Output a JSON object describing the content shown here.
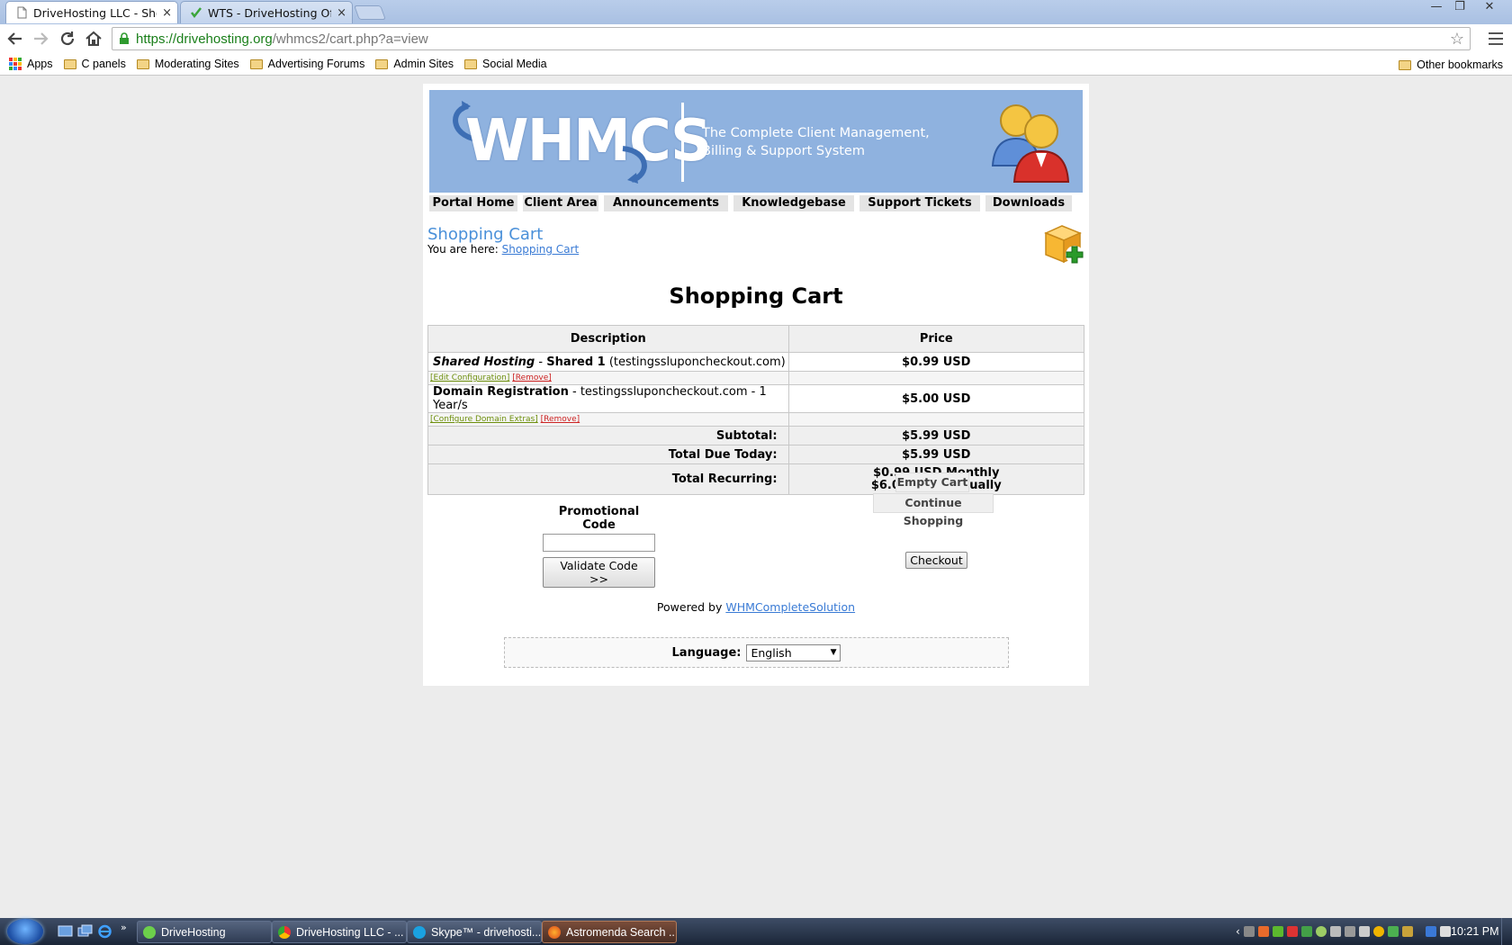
{
  "browser": {
    "tabs": [
      {
        "title": "DriveHosting LLC - Shopp",
        "active": true
      },
      {
        "title": "WTS - DriveHosting Offici",
        "active": false
      }
    ],
    "close_glyph": "×",
    "window_controls": {
      "minimize": "—",
      "restore": "❐",
      "close": "✕"
    },
    "url_scheme_host": "https://drivehosting.org",
    "url_path": "/whmcs2/cart.php?a=view",
    "bookmarks": [
      "Apps",
      "C panels",
      "Moderating Sites",
      "Advertising Forums",
      "Admin Sites",
      "Social Media"
    ],
    "other_bookmarks": "Other bookmarks"
  },
  "banner": {
    "logo": "WHMCS",
    "tagline_line1": "The Complete Client Management,",
    "tagline_line2": "Billing & Support System"
  },
  "nav": {
    "items": [
      "Portal Home",
      "Client Area",
      "Announcements",
      "Knowledgebase",
      "Support Tickets",
      "Downloads"
    ]
  },
  "page": {
    "heading": "Shopping Cart",
    "breadcrumb_prefix": "You are here:",
    "breadcrumb_link": "Shopping Cart",
    "cart_title": "Shopping Cart"
  },
  "cart": {
    "col_description": "Description",
    "col_price": "Price",
    "items": [
      {
        "category": "Shared Hosting",
        "sep": " - ",
        "name": "Shared 1",
        "detail": " (testingssluponcheckout.com)",
        "price": "$0.99 USD",
        "link1": "[Edit Configuration]",
        "link2": "[Remove]"
      },
      {
        "category": "Domain Registration",
        "sep": " - ",
        "name": "",
        "detail": "testingssluponcheckout.com - 1 Year/s",
        "price": "$5.00 USD",
        "link1": "[Configure Domain Extras]",
        "link2": "[Remove]"
      }
    ],
    "subtotal_label": "Subtotal:",
    "subtotal_value": "$5.99 USD",
    "due_label": "Total Due Today:",
    "due_value": "$5.99 USD",
    "recurring_label": "Total Recurring:",
    "recurring_monthly": "$0.99 USD Monthly",
    "recurring_annually": "$6.00 USD Annually"
  },
  "promo": {
    "label": "Promotional Code",
    "value": "",
    "button": "Validate Code >>"
  },
  "actions": {
    "empty": "Empty Cart",
    "continue": "Continue Shopping",
    "checkout": "Checkout"
  },
  "footer": {
    "powered_prefix": "Powered by",
    "powered_link": "WHMCompleteSolution",
    "language_label": "Language:",
    "language_value": "English"
  },
  "taskbar": {
    "tasks": [
      "DriveHosting",
      "DriveHosting LLC - ...",
      "Skype™ - drivehosti...",
      "Astromenda Search ..."
    ],
    "clock": "10:21 PM"
  },
  "colors": {
    "banner_bg": "#8fb2df",
    "link_blue": "#3a7bd5",
    "edit_green": "#6d8f0c",
    "remove_red": "#cc2222",
    "page_bg": "#ececec"
  }
}
